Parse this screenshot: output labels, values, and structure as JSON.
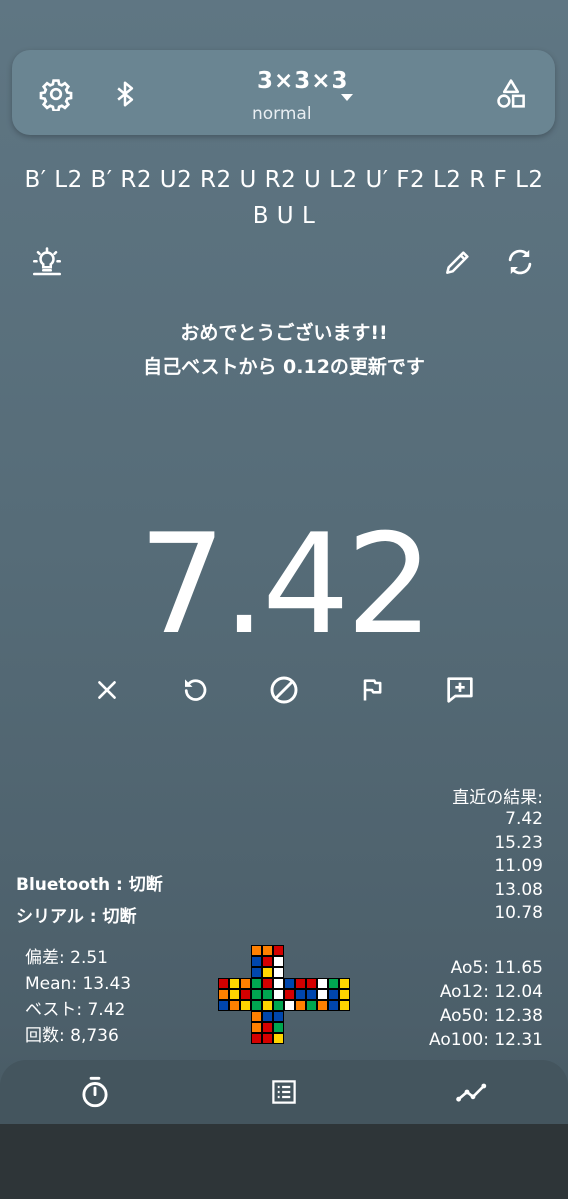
{
  "topbar": {
    "puzzle": "3×3×3",
    "mode": "normal",
    "icons": [
      "gear-icon",
      "bluetooth-icon",
      "dropdown-arrow-icon",
      "shapes-icon"
    ]
  },
  "scramble": "B′ L2 B′ R2 U2 R2 U R2 U L2 U′ F2 L2 R F L2 B U L",
  "tools": [
    "bulb-icon",
    "pencil-icon",
    "refresh-icon"
  ],
  "message": {
    "line1": "おめでとうございます!!",
    "line2": "自己ベストから 0.12の更新です"
  },
  "timer": {
    "value": "7.42"
  },
  "actions": [
    "close-icon",
    "undo-icon",
    "dnf-icon",
    "flag-icon",
    "add-comment-icon"
  ],
  "recent": {
    "title": "直近の結果:",
    "times": [
      "7.42",
      "15.23",
      "11.09",
      "13.08",
      "10.78"
    ]
  },
  "connection": {
    "bluetooth": "Bluetooth : 切断",
    "serial": "シリアル : 切断"
  },
  "stats": {
    "deviation": "偏差: 2.51",
    "mean": "Mean: 13.43",
    "best": "ベスト: 7.42",
    "count": "回数: 8,736"
  },
  "averages": {
    "ao5": "Ao5: 11.65",
    "ao12": "Ao12: 12.04",
    "ao50": "Ao50: 12.38",
    "ao100": "Ao100: 12.31"
  },
  "cube_net": {
    "colors": {
      "W": "#ffffff",
      "Y": "#ffd500",
      "R": "#d40000",
      "O": "#ff8000",
      "G": "#00a650",
      "B": "#0046ad"
    },
    "U": [
      "OOR",
      "BRW",
      "BYW"
    ],
    "L": [
      "RYO",
      "OYR",
      "BOY"
    ],
    "F": [
      "GRW",
      "GGW",
      "GYG"
    ],
    "R": [
      "BRR",
      "RBB",
      "WOG"
    ],
    "B": [
      "WGY",
      "WBY",
      "OBY"
    ],
    "D": [
      "OBB",
      "ORG",
      "RRY"
    ]
  },
  "nav": [
    "timer-icon",
    "list-icon",
    "chart-icon"
  ],
  "accent": "#6a8592"
}
